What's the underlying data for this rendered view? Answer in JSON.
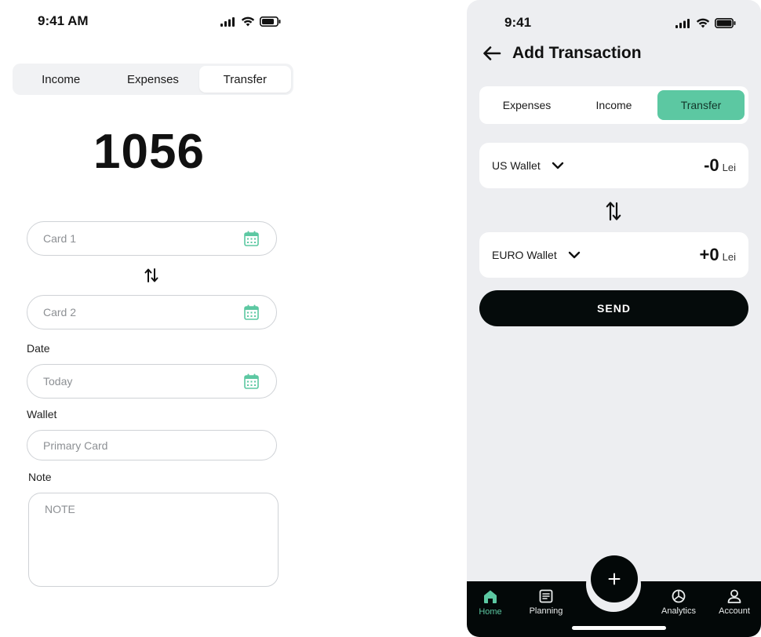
{
  "left_screen": {
    "status_time": "9:41 AM",
    "tabs": [
      "Income",
      "Expenses",
      "Transfer"
    ],
    "active_tab": "Transfer",
    "amount": "1056",
    "card1_placeholder": "Card 1",
    "card2_placeholder": "Card 2",
    "date_label": "Date",
    "date_placeholder": "Today",
    "wallet_label": "Wallet",
    "wallet_placeholder": "Primary Card",
    "note_label": "Note",
    "note_placeholder": "NOTE"
  },
  "right_screen": {
    "status_time": "9:41",
    "title": "Add Transaction",
    "tabs": [
      "Expenses",
      "Income",
      "Transfer"
    ],
    "active_tab": "Transfer",
    "from_wallet": {
      "name": "US Wallet",
      "amount": "-0",
      "currency": "Lei"
    },
    "to_wallet": {
      "name": "EURO Wallet",
      "amount": "+0",
      "currency": "Lei"
    },
    "send_label": "SEND",
    "nav": [
      {
        "label": "Home",
        "icon": "home-icon"
      },
      {
        "label": "Planning",
        "icon": "planning-icon"
      },
      {
        "label": "Analytics",
        "icon": "analytics-icon"
      },
      {
        "label": "Account",
        "icon": "account-icon"
      }
    ],
    "fab_icon": "plus-icon"
  },
  "colors": {
    "accent": "#5cc8a2",
    "dark": "#030808",
    "panel_bg": "#edeef1"
  }
}
